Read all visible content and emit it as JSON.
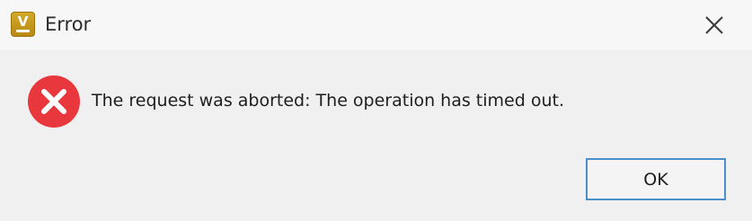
{
  "window": {
    "title": "Error",
    "app_icon": "app-v-icon",
    "app_icon_letter": "V",
    "close_icon": "close-icon"
  },
  "message": {
    "icon": "error-x-icon",
    "text": "The request was aborted: The operation has timed out."
  },
  "buttons": {
    "ok_label": "OK"
  },
  "colors": {
    "error_red": "#e8383d",
    "accent_border": "#4a8fcc",
    "app_icon_gold": "#c99a1c"
  }
}
